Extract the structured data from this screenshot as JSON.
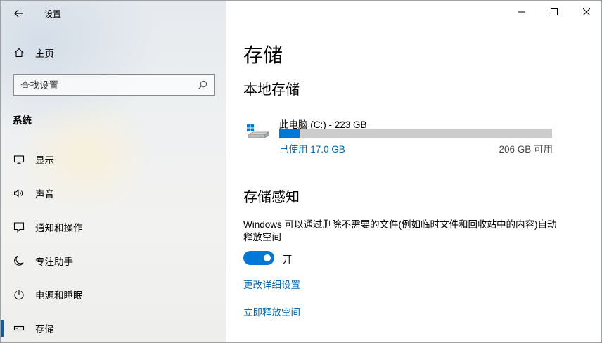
{
  "app": {
    "title": "设置"
  },
  "sidebar": {
    "home_label": "主页",
    "search_placeholder": "查找设置",
    "section": "系统",
    "items": [
      {
        "label": "显示",
        "icon": "monitor-icon"
      },
      {
        "label": "声音",
        "icon": "speaker-icon"
      },
      {
        "label": "通知和操作",
        "icon": "notification-icon"
      },
      {
        "label": "专注助手",
        "icon": "moon-icon"
      },
      {
        "label": "电源和睡眠",
        "icon": "power-icon"
      },
      {
        "label": "存储",
        "icon": "storage-icon",
        "active": true
      }
    ]
  },
  "main": {
    "title": "存储",
    "local_storage": {
      "heading": "本地存储",
      "drive_name": "此电脑 (C:) - 223 GB",
      "used_label": "已使用 17.0 GB",
      "free_label": "206 GB 可用",
      "used_fraction": 0.076
    },
    "storage_sense": {
      "heading": "存储感知",
      "description": "Windows 可以通过删除不需要的文件(例如临时文件和回收站中的内容)自动释放空间",
      "toggle_state": "开",
      "toggle_on": true,
      "links": [
        "更改详细设置",
        "立即释放空间"
      ]
    }
  },
  "colors": {
    "accent": "#0078d7",
    "link": "#0067b8",
    "bar_track": "#cccccc"
  }
}
